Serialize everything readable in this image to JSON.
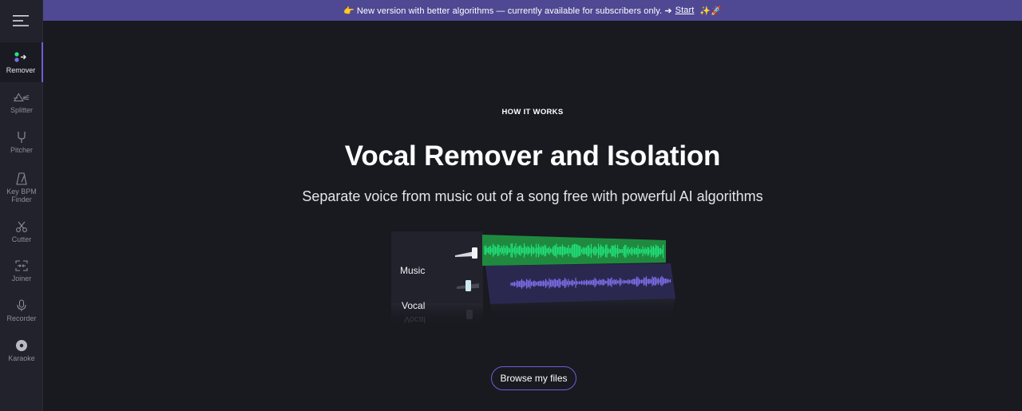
{
  "banner": {
    "emoji_start": "👉",
    "text": "New version with better algorithms — currently available for subscribers only. ➔",
    "link": "Start",
    "emoji_end": "✨🚀"
  },
  "sidebar": {
    "menu_icon": "hamburger-menu-icon",
    "items": [
      {
        "label": "Remover",
        "icon": "remover-icon",
        "active": true
      },
      {
        "label": "Splitter",
        "icon": "prism-icon"
      },
      {
        "label": "Pitcher",
        "icon": "tuning-fork-icon"
      },
      {
        "label": "Key BPM Finder",
        "icon": "metronome-icon"
      },
      {
        "label": "Cutter",
        "icon": "scissors-icon"
      },
      {
        "label": "Joiner",
        "icon": "join-icon"
      },
      {
        "label": "Recorder",
        "icon": "microphone-icon"
      },
      {
        "label": "Karaoke",
        "icon": "disc-icon"
      }
    ]
  },
  "hero": {
    "eyebrow": "HOW IT WORKS",
    "title": "Vocal Remover and Isolation",
    "subtitle": "Separate voice from music out of a song free with powerful AI algorithms"
  },
  "mixer": {
    "tracks": [
      {
        "label": "Music",
        "color": "#21e07a",
        "band": "#1f8a3f"
      },
      {
        "label": "Vocal",
        "color": "#7c6ee8",
        "band": "#2e2a55"
      }
    ],
    "reflection_label": "Vocal"
  },
  "cta": {
    "browse_label": "Browse my files"
  },
  "colors": {
    "accent": "#6c5fd6",
    "banner": "#4f4893",
    "background": "#191920",
    "sidebar": "#21222b"
  }
}
